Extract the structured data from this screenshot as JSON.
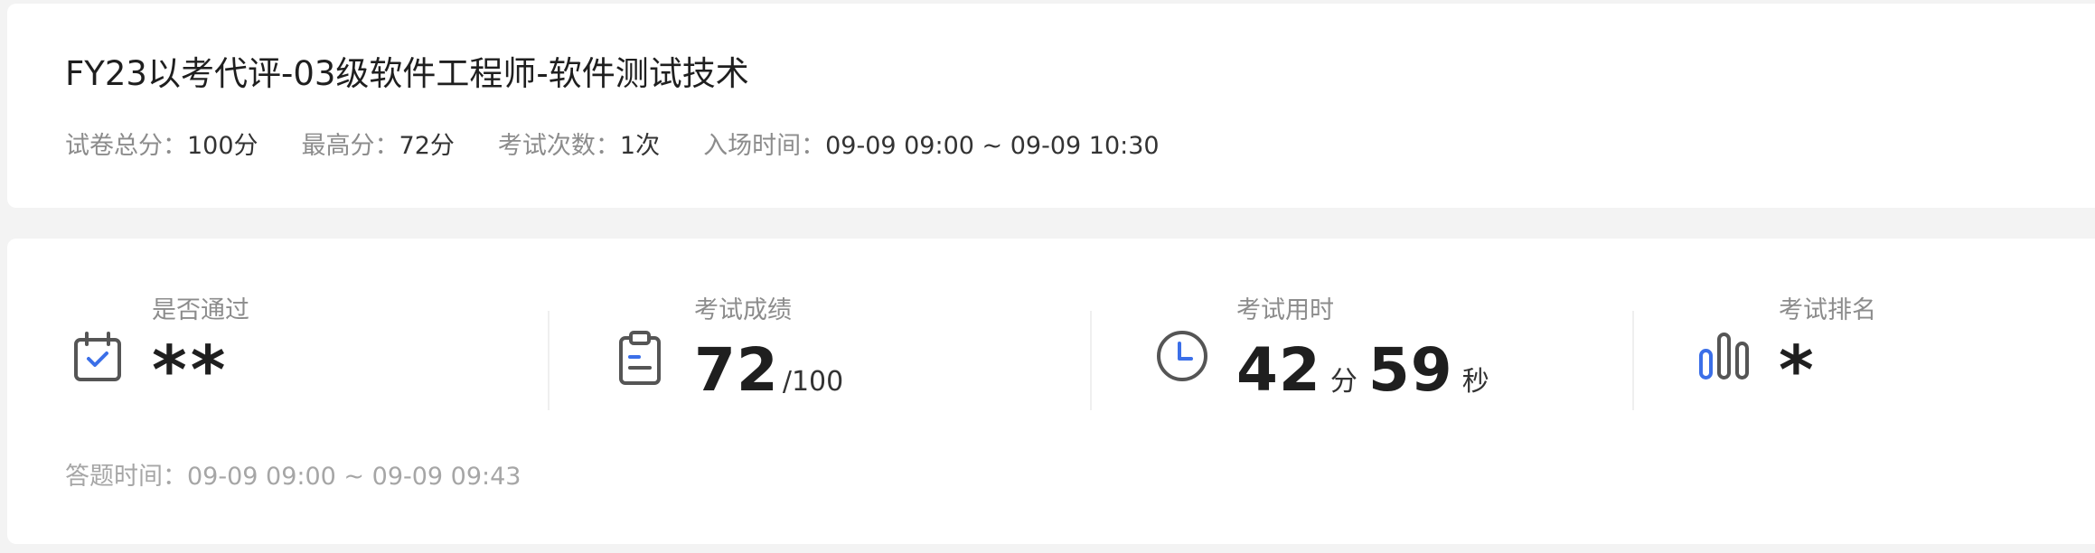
{
  "exam": {
    "title": "FY23以考代评-03级软件工程师-软件测试技术",
    "meta": [
      {
        "label": "试卷总分：",
        "value": "100分"
      },
      {
        "label": "最高分：",
        "value": "72分"
      },
      {
        "label": "考试次数：",
        "value": "1次"
      },
      {
        "label": "入场时间：",
        "value": "09-09 09:00 ~ 09-09 10:30"
      }
    ]
  },
  "stats": {
    "pass": {
      "label": "是否通过",
      "value": "**",
      "icon": "calendar-check-icon"
    },
    "score": {
      "label": "考试成绩",
      "value": "72",
      "total": "/100",
      "icon": "clipboard-icon"
    },
    "duration": {
      "label": "考试用时",
      "minutes": "42",
      "minutes_unit": "分",
      "seconds": "59",
      "seconds_unit": "秒",
      "icon": "clock-icon"
    },
    "rank": {
      "label": "考试排名",
      "value": "*",
      "icon": "bar-ranking-icon"
    }
  },
  "answer_time": {
    "label": "答题时间：",
    "value": "09-09 09:00 ~ 09-09 09:43"
  },
  "colors": {
    "accent": "#3b6fe8",
    "icon_gray": "#555555",
    "label_gray": "#8c8c8c",
    "background": "#f3f3f3"
  }
}
